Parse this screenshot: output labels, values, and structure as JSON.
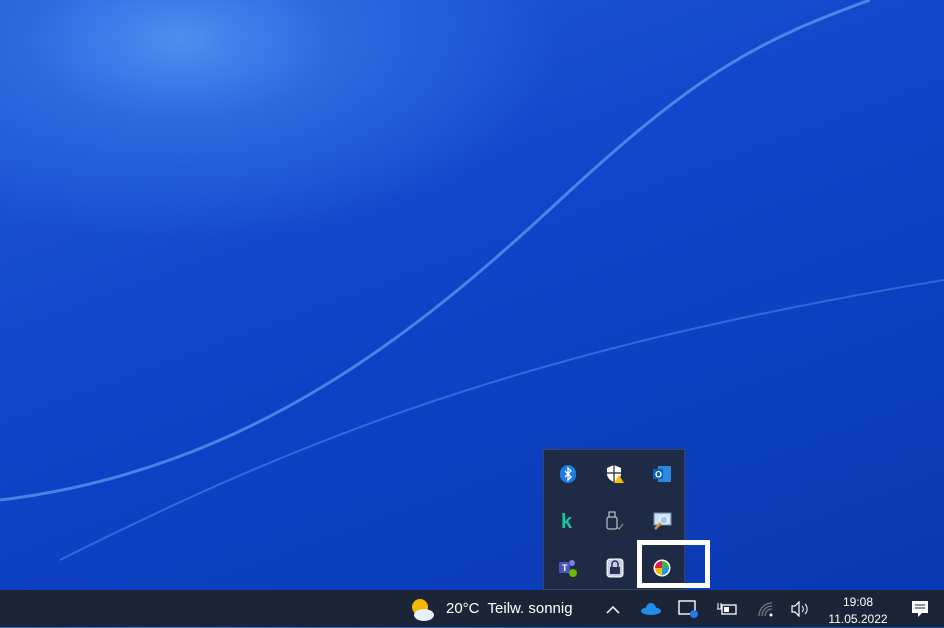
{
  "tray_popup": {
    "icons": [
      "bluetooth-icon",
      "windows-security-warning-icon",
      "outlook-icon",
      "kaspersky-icon",
      "usb-eject-icon",
      "screen-zoom-icon",
      "teams-icon",
      "lock-icon",
      "color-wheel-icon"
    ]
  },
  "taskbar": {
    "weather": {
      "temp": "20°C",
      "condition": "Teilw. sonnig"
    },
    "clock": {
      "time": "19:08",
      "date": "11.05.2022"
    }
  },
  "colors": {
    "taskbar": "#1c2537",
    "tray": "#1f2a44",
    "highlight": "#ffffff"
  }
}
